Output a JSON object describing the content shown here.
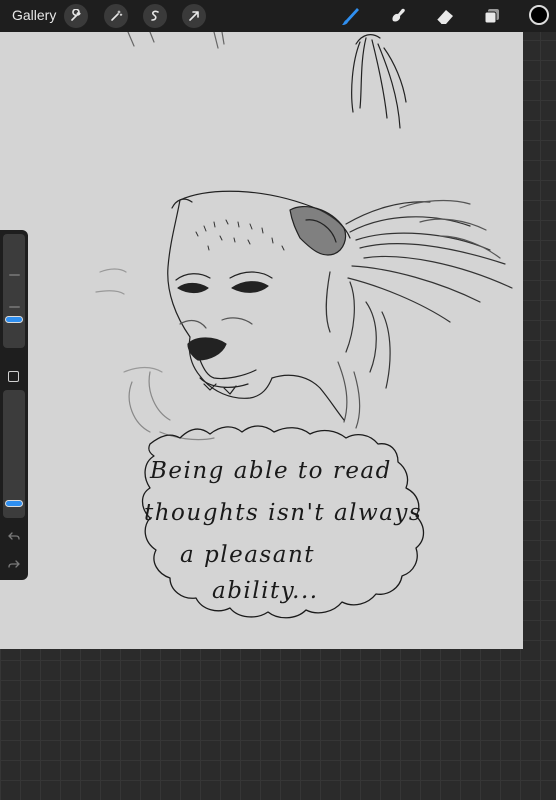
{
  "toolbar": {
    "gallery_label": "Gallery",
    "left_tools": [
      "wrench-icon",
      "magic-wand-icon",
      "selection-icon",
      "transform-arrow-icon"
    ],
    "right_tools": [
      "brush-icon",
      "smudge-icon",
      "eraser-icon",
      "layers-icon"
    ],
    "active_tool": "brush",
    "accent_color": "#2f8ff0",
    "current_color": "#000000"
  },
  "sidebar": {
    "brush_size": 0.25,
    "opacity": 0.1
  },
  "canvas": {
    "background_color": "#d4d4d4",
    "caption_lines": [
      "Being able to read",
      "thoughts isn't always",
      "a pleasant",
      "ability..."
    ]
  }
}
